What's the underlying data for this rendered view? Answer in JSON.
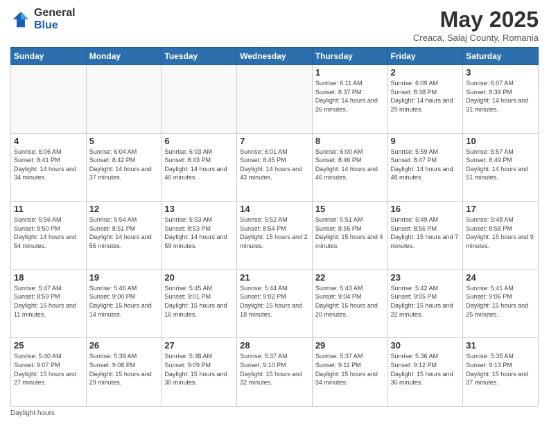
{
  "logo": {
    "general": "General",
    "blue": "Blue"
  },
  "title": "May 2025",
  "subtitle": "Creaca, Salaj County, Romania",
  "days_header": [
    "Sunday",
    "Monday",
    "Tuesday",
    "Wednesday",
    "Thursday",
    "Friday",
    "Saturday"
  ],
  "weeks": [
    [
      {
        "day": "",
        "info": ""
      },
      {
        "day": "",
        "info": ""
      },
      {
        "day": "",
        "info": ""
      },
      {
        "day": "",
        "info": ""
      },
      {
        "day": "1",
        "info": "Sunrise: 6:11 AM\nSunset: 8:37 PM\nDaylight: 14 hours and 26 minutes."
      },
      {
        "day": "2",
        "info": "Sunrise: 6:09 AM\nSunset: 8:38 PM\nDaylight: 14 hours and 29 minutes."
      },
      {
        "day": "3",
        "info": "Sunrise: 6:07 AM\nSunset: 8:39 PM\nDaylight: 14 hours and 31 minutes."
      }
    ],
    [
      {
        "day": "4",
        "info": "Sunrise: 6:06 AM\nSunset: 8:41 PM\nDaylight: 14 hours and 34 minutes."
      },
      {
        "day": "5",
        "info": "Sunrise: 6:04 AM\nSunset: 8:42 PM\nDaylight: 14 hours and 37 minutes."
      },
      {
        "day": "6",
        "info": "Sunrise: 6:03 AM\nSunset: 8:43 PM\nDaylight: 14 hours and 40 minutes."
      },
      {
        "day": "7",
        "info": "Sunrise: 6:01 AM\nSunset: 8:45 PM\nDaylight: 14 hours and 43 minutes."
      },
      {
        "day": "8",
        "info": "Sunrise: 6:00 AM\nSunset: 8:46 PM\nDaylight: 14 hours and 46 minutes."
      },
      {
        "day": "9",
        "info": "Sunrise: 5:59 AM\nSunset: 8:47 PM\nDaylight: 14 hours and 48 minutes."
      },
      {
        "day": "10",
        "info": "Sunrise: 5:57 AM\nSunset: 8:49 PM\nDaylight: 14 hours and 51 minutes."
      }
    ],
    [
      {
        "day": "11",
        "info": "Sunrise: 5:56 AM\nSunset: 8:50 PM\nDaylight: 14 hours and 54 minutes."
      },
      {
        "day": "12",
        "info": "Sunrise: 5:54 AM\nSunset: 8:51 PM\nDaylight: 14 hours and 56 minutes."
      },
      {
        "day": "13",
        "info": "Sunrise: 5:53 AM\nSunset: 8:53 PM\nDaylight: 14 hours and 59 minutes."
      },
      {
        "day": "14",
        "info": "Sunrise: 5:52 AM\nSunset: 8:54 PM\nDaylight: 15 hours and 2 minutes."
      },
      {
        "day": "15",
        "info": "Sunrise: 5:51 AM\nSunset: 8:55 PM\nDaylight: 15 hours and 4 minutes."
      },
      {
        "day": "16",
        "info": "Sunrise: 5:49 AM\nSunset: 8:56 PM\nDaylight: 15 hours and 7 minutes."
      },
      {
        "day": "17",
        "info": "Sunrise: 5:48 AM\nSunset: 8:58 PM\nDaylight: 15 hours and 9 minutes."
      }
    ],
    [
      {
        "day": "18",
        "info": "Sunrise: 5:47 AM\nSunset: 8:59 PM\nDaylight: 15 hours and 11 minutes."
      },
      {
        "day": "19",
        "info": "Sunrise: 5:46 AM\nSunset: 9:00 PM\nDaylight: 15 hours and 14 minutes."
      },
      {
        "day": "20",
        "info": "Sunrise: 5:45 AM\nSunset: 9:01 PM\nDaylight: 15 hours and 16 minutes."
      },
      {
        "day": "21",
        "info": "Sunrise: 5:44 AM\nSunset: 9:02 PM\nDaylight: 15 hours and 18 minutes."
      },
      {
        "day": "22",
        "info": "Sunrise: 5:43 AM\nSunset: 9:04 PM\nDaylight: 15 hours and 20 minutes."
      },
      {
        "day": "23",
        "info": "Sunrise: 5:42 AM\nSunset: 9:05 PM\nDaylight: 15 hours and 22 minutes."
      },
      {
        "day": "24",
        "info": "Sunrise: 5:41 AM\nSunset: 9:06 PM\nDaylight: 15 hours and 25 minutes."
      }
    ],
    [
      {
        "day": "25",
        "info": "Sunrise: 5:40 AM\nSunset: 9:07 PM\nDaylight: 15 hours and 27 minutes."
      },
      {
        "day": "26",
        "info": "Sunrise: 5:39 AM\nSunset: 9:08 PM\nDaylight: 15 hours and 29 minutes."
      },
      {
        "day": "27",
        "info": "Sunrise: 5:38 AM\nSunset: 9:09 PM\nDaylight: 15 hours and 30 minutes."
      },
      {
        "day": "28",
        "info": "Sunrise: 5:37 AM\nSunset: 9:10 PM\nDaylight: 15 hours and 32 minutes."
      },
      {
        "day": "29",
        "info": "Sunrise: 5:37 AM\nSunset: 9:11 PM\nDaylight: 15 hours and 34 minutes."
      },
      {
        "day": "30",
        "info": "Sunrise: 5:36 AM\nSunset: 9:12 PM\nDaylight: 15 hours and 36 minutes."
      },
      {
        "day": "31",
        "info": "Sunrise: 5:35 AM\nSunset: 9:13 PM\nDaylight: 15 hours and 37 minutes."
      }
    ]
  ],
  "footer": "Daylight hours"
}
